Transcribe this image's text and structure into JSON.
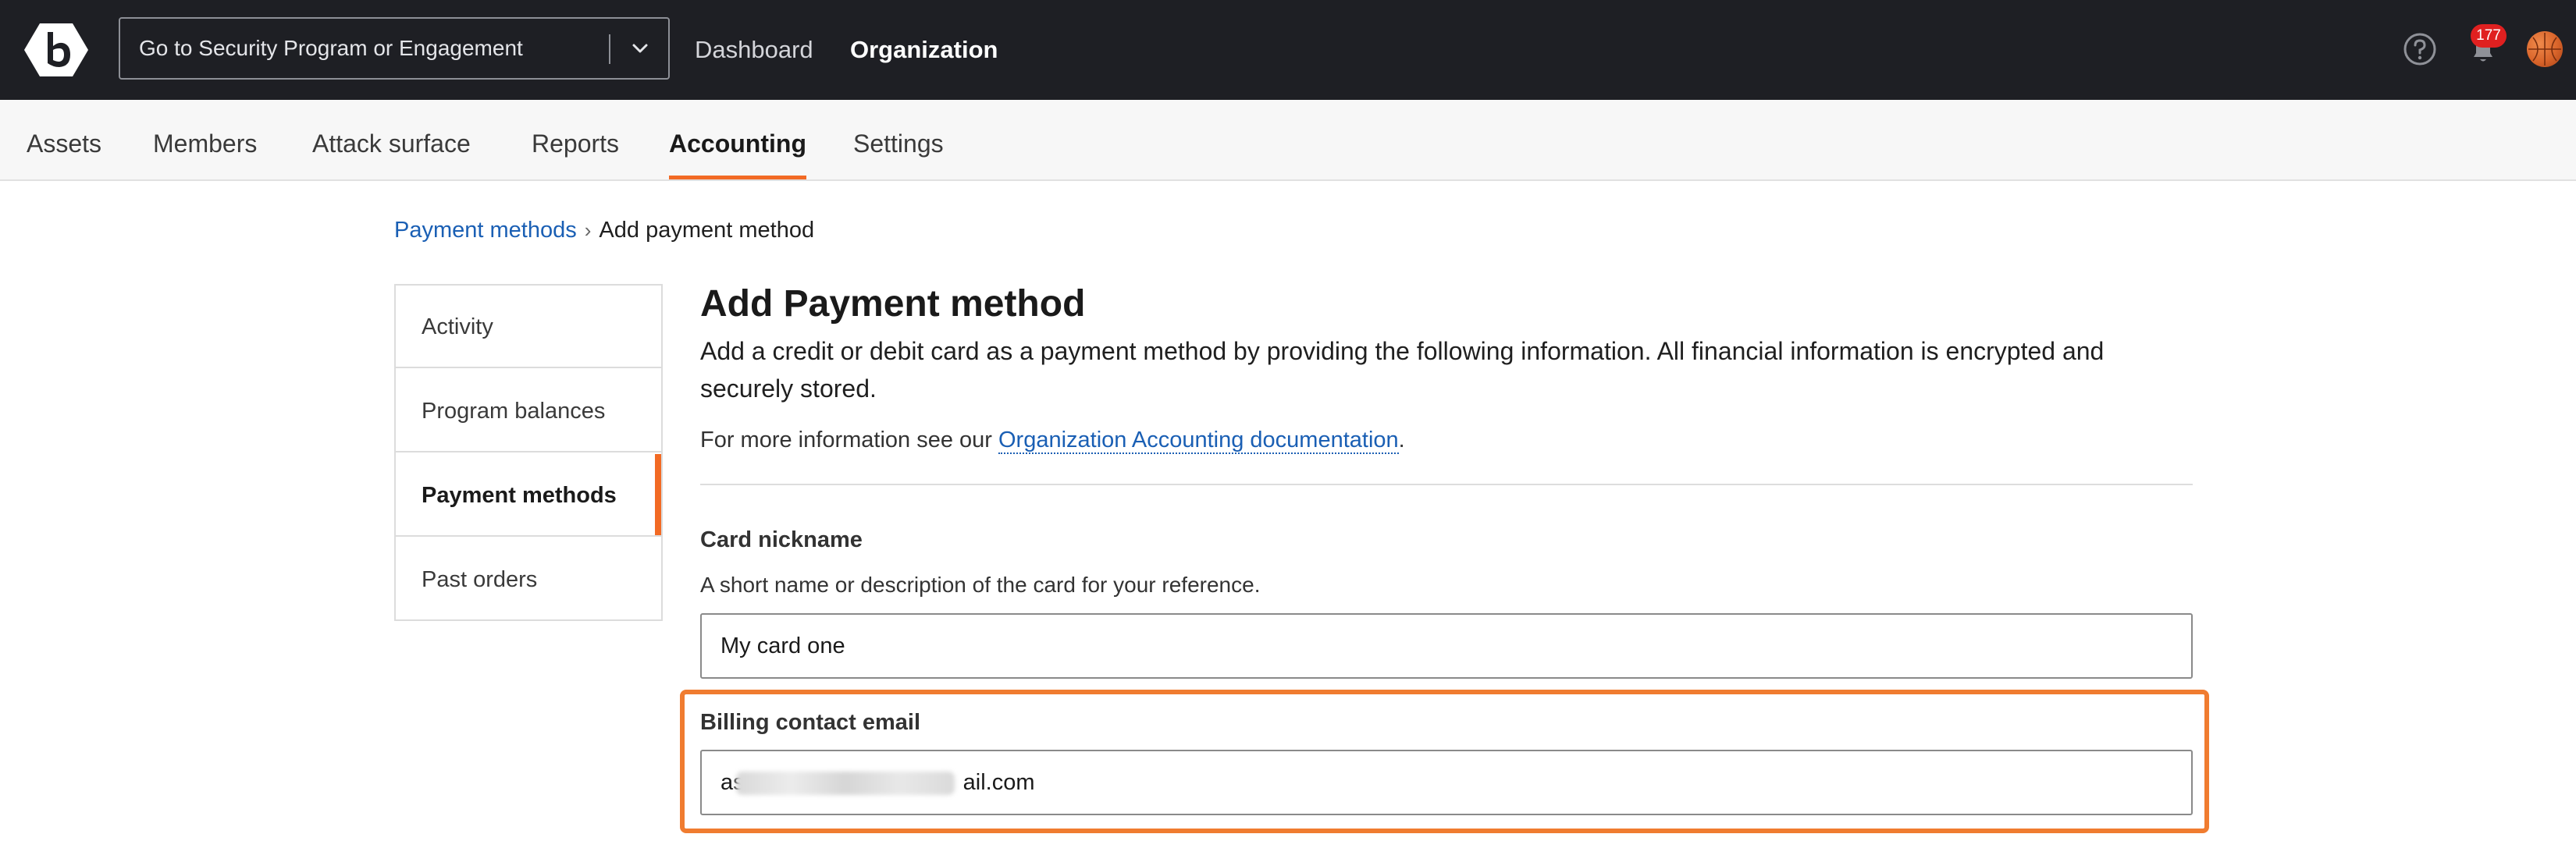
{
  "header": {
    "logo_icon": "bugcrowd-hexagon-b-icon",
    "program_select": {
      "value": "Go to Security Program or Engagement"
    },
    "nav": {
      "dashboard": "Dashboard",
      "organization": "Organization"
    },
    "notifications_count": "177",
    "icons": [
      "help-circle-icon",
      "bell-icon",
      "avatar"
    ]
  },
  "subnav": {
    "tabs": [
      {
        "label": "Assets"
      },
      {
        "label": "Members"
      },
      {
        "label": "Attack surface"
      },
      {
        "label": "Reports"
      },
      {
        "label": "Accounting",
        "active": true
      },
      {
        "label": "Settings"
      }
    ]
  },
  "breadcrumb": {
    "parent": "Payment methods",
    "separator": "›",
    "current": "Add payment method"
  },
  "side_menu": {
    "items": [
      {
        "label": "Activity"
      },
      {
        "label": "Program balances"
      },
      {
        "label": "Payment methods",
        "active": true
      },
      {
        "label": "Past orders"
      }
    ]
  },
  "main": {
    "title": "Add Payment method",
    "description": "Add a credit or debit card as a payment method by providing the following information. All financial information is encrypted and securely stored.",
    "more_info_prefix": "For more information see our ",
    "more_info_link": "Organization Accounting documentation",
    "more_info_suffix": ".",
    "card_nickname": {
      "label": "Card nickname",
      "help": "A short name or description of the card for your reference.",
      "value": "My card one"
    },
    "billing_email": {
      "label": "Billing contact email",
      "value_visible_start": "as",
      "value_visible_end": "ail.com",
      "value_redacted": true
    }
  },
  "colors": {
    "header_bg": "#1e1f24",
    "accent": "#f26a24",
    "highlight": "#f07c30",
    "link": "#1a5fb4",
    "badge": "#e02020"
  }
}
